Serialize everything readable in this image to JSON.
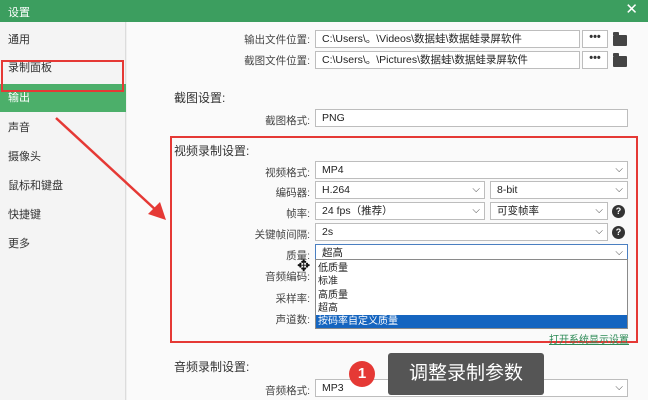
{
  "window": {
    "title": "设置"
  },
  "sidebar": {
    "items": [
      {
        "label": "通用"
      },
      {
        "label": "录制面板"
      },
      {
        "label": "输出"
      },
      {
        "label": "声音"
      },
      {
        "label": "摄像头"
      },
      {
        "label": "鼠标和键盘"
      },
      {
        "label": "快捷键"
      },
      {
        "label": "更多"
      }
    ],
    "active_index": 2
  },
  "output": {
    "output_location_label": "输出文件位置:",
    "output_location_value": "C:\\Users\\。\\Videos\\数据蛙\\数据蛙录屏软件",
    "screenshot_location_label": "截图文件位置:",
    "screenshot_location_value": "C:\\Users\\。\\Pictures\\数据蛙\\数据蛙录屏软件",
    "browse_label": "•••"
  },
  "screenshot": {
    "section_title": "截图设置:",
    "format_label": "截图格式:",
    "format_value": "PNG"
  },
  "video": {
    "section_title": "视频录制设置:",
    "format_label": "视频格式:",
    "format_value": "MP4",
    "codec_label": "编码器:",
    "codec_value": "H.264",
    "bitdepth_value": "8-bit",
    "fps_label": "帧率:",
    "fps_value": "24 fps（推荐）",
    "fps_mode_value": "可变帧率",
    "keyframe_label": "关键帧间隔:",
    "keyframe_value": "2s",
    "quality_label": "质量:",
    "quality_value": "超高",
    "audio_codec_label": "音频编码:",
    "sample_rate_label": "采样率:",
    "channels_label": "声道数:",
    "quality_options": [
      "低质量",
      "标准",
      "高质量",
      "超高",
      "按码率自定义质量"
    ],
    "quality_selected_index": 4,
    "open_display_settings": "打开系统显示设置"
  },
  "audio": {
    "section_title": "音频录制设置:",
    "format_label": "音频格式:",
    "format_value": "MP3"
  },
  "annotation": {
    "number": "1",
    "text": "调整录制参数",
    "color": "#e53935"
  },
  "help_symbol": "?",
  "chevron_symbol": "⌵"
}
